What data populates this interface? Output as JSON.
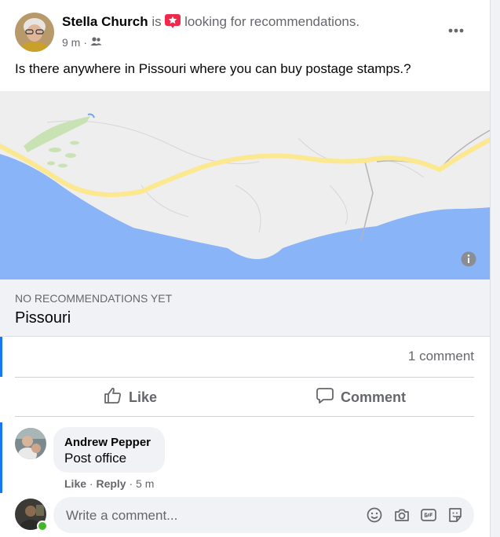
{
  "post": {
    "author": "Stella Church",
    "is_word": "is",
    "status": "looking for recommendations.",
    "time": "9 m",
    "dot": "·",
    "text": "Is there anywhere in Pissouri where you can buy postage stamps.?"
  },
  "recommendation": {
    "status": "NO RECOMMENDATIONS YET",
    "place": "Pissouri"
  },
  "engagement": {
    "comment_count": "1 comment",
    "like_label": "Like",
    "comment_label": "Comment"
  },
  "comment": {
    "author": "Andrew Pepper",
    "text": "Post office",
    "like": "Like",
    "reply": "Reply",
    "sep": "·",
    "time": "5 m"
  },
  "composer": {
    "placeholder": "Write a comment..."
  },
  "icons": {
    "more": "more-options-icon",
    "privacy": "friends-privacy-icon",
    "recommend": "recommendation-star-icon",
    "info": "info-icon",
    "like": "thumbs-up-icon",
    "comment": "comment-bubble-icon",
    "emoji": "emoji-icon",
    "camera": "camera-icon",
    "gif": "gif-icon",
    "sticker": "sticker-icon"
  },
  "colors": {
    "accent": "#1877f2",
    "water": "#8ab4f8",
    "road": "#fbe88f",
    "online": "#42b72a"
  }
}
